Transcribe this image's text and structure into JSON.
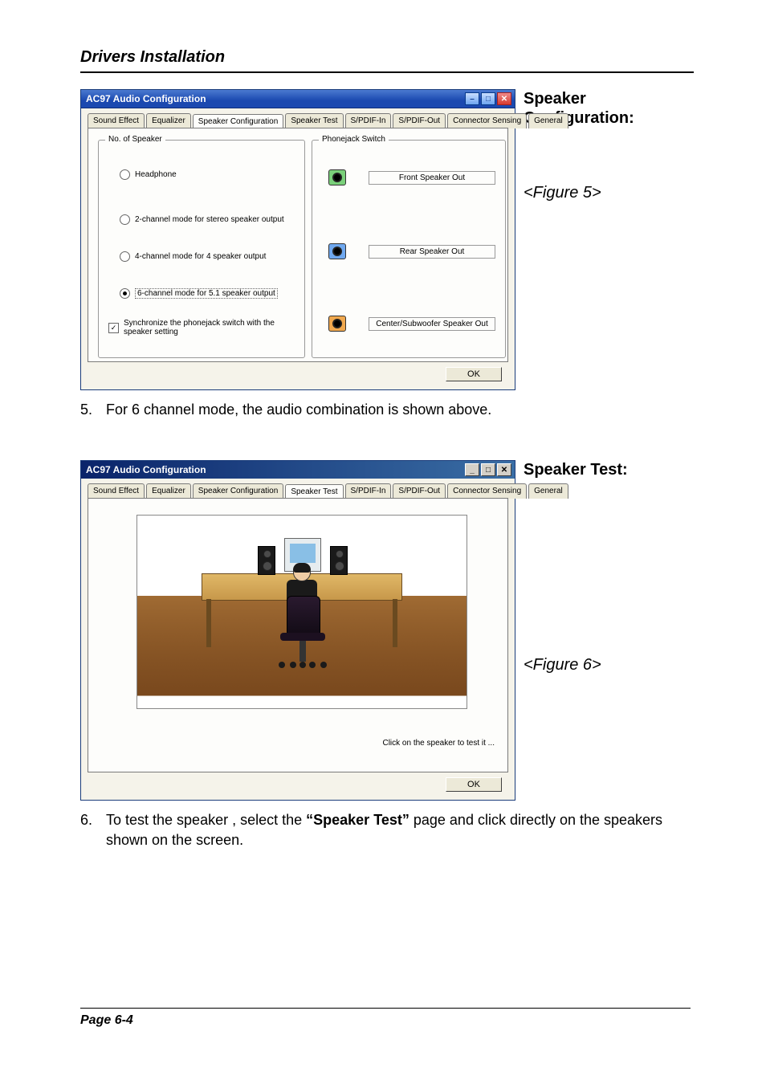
{
  "page": {
    "title": "Drivers Installation",
    "footer": "Page 6-4"
  },
  "fig5": {
    "side_title": "Speaker Configuration:",
    "caption": "<Figure 5>",
    "window_title": "AC97 Audio Configuration",
    "tabs": {
      "t0": "Sound Effect",
      "t1": "Equalizer",
      "t2": "Speaker Configuration",
      "t3": "Speaker Test",
      "t4": "S/PDIF-In",
      "t5": "S/PDIF-Out",
      "t6": "Connector Sensing",
      "t7": "General"
    },
    "group_num": "No. of Speaker",
    "group_jack": "Phonejack Switch",
    "radio_headphone": "Headphone",
    "radio_2ch": "2-channel mode for stereo speaker output",
    "radio_4ch": "4-channel mode for 4 speaker output",
    "radio_6ch": "6-channel mode for 5.1 speaker output",
    "check_sync": "Synchronize the phonejack switch with the speaker setting",
    "jack_front": "Front Speaker Out",
    "jack_rear": "Rear Speaker Out",
    "jack_center": "Center/Subwoofer Speaker Out",
    "ok": "OK"
  },
  "step5": {
    "n": "5.",
    "text": "For 6 channel mode, the audio combination is shown above."
  },
  "fig6": {
    "side_title": "Speaker Test:",
    "caption": "<Figure 6>",
    "window_title": "AC97 Audio Configuration",
    "tabs": {
      "t0": "Sound Effect",
      "t1": "Equalizer",
      "t2": "Speaker Configuration",
      "t3": "Speaker Test",
      "t4": "S/PDIF-In",
      "t5": "S/PDIF-Out",
      "t6": "Connector Sensing",
      "t7": "General"
    },
    "hint": "Click on the speaker to test it ...",
    "ok": "OK"
  },
  "step6": {
    "n": "6.",
    "text_pre": "To test the speaker , select the ",
    "text_bold": "“Speaker Test”",
    "text_post": " page and click directly on the speakers shown on the screen."
  }
}
